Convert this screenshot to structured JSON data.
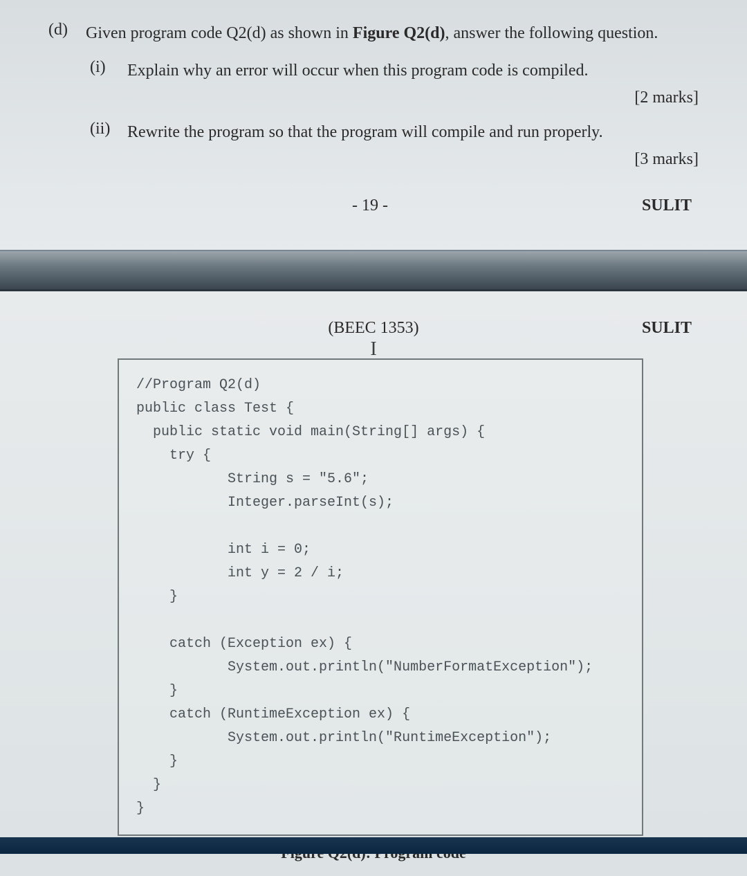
{
  "question": {
    "label": "(d)",
    "text_before": "Given program code Q2(d) as shown in ",
    "text_bold": "Figure Q2(d)",
    "text_after": ", answer the following question.",
    "items": [
      {
        "label": "(i)",
        "text": "Explain why an error will occur when this program code is compiled.",
        "marks": "[2 marks]"
      },
      {
        "label": "(ii)",
        "text": "Rewrite the program so that the program will compile and run properly.",
        "marks": "[3 marks]"
      }
    ]
  },
  "page_footer": {
    "page_num": "- 19 -",
    "classification": "SULIT"
  },
  "page_header": {
    "course_code": "(BEEC 1353)",
    "classification": "SULIT"
  },
  "code": {
    "line1": "//Program Q2(d)",
    "line2": "public class Test {",
    "line3": "  public static void main(String[] args) {",
    "line4": "    try {",
    "line5": "           String s = \"5.6\";",
    "line6": "           Integer.parseInt(s);",
    "line7": "",
    "line8": "           int i = 0;",
    "line9": "           int y = 2 / i;",
    "line10": "    }",
    "line11": "",
    "line12": "    catch (Exception ex) {",
    "line13": "           System.out.println(\"NumberFormatException\");",
    "line14": "    }",
    "line15": "    catch (RuntimeException ex) {",
    "line16": "           System.out.println(\"RuntimeException\");",
    "line17": "    }",
    "line18": "  }",
    "line19": "}"
  },
  "figure_caption": "Figure Q2(d): Program code"
}
